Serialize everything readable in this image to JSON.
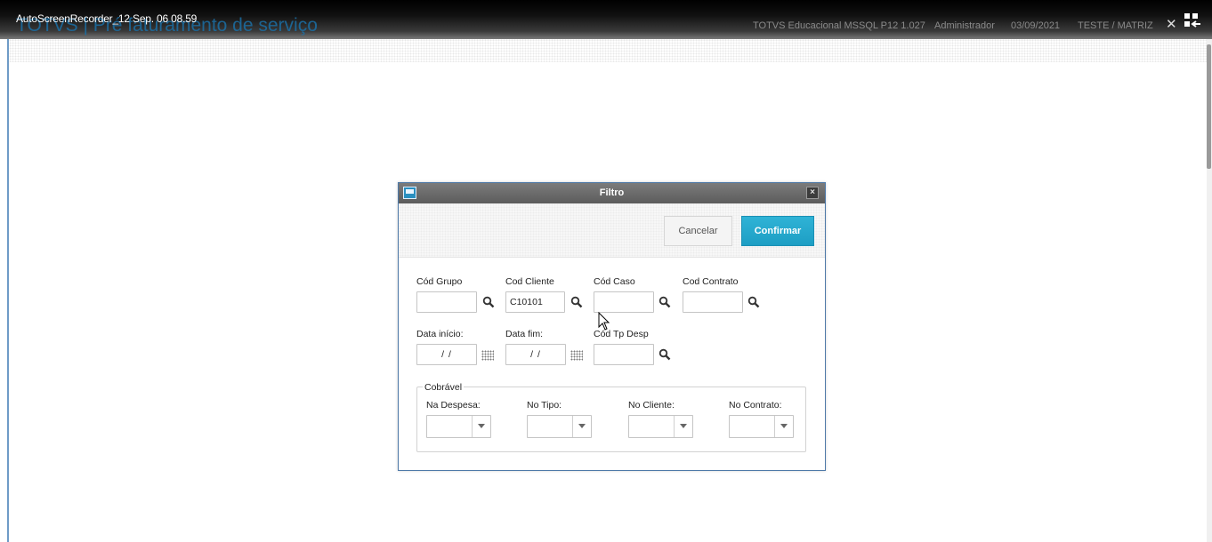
{
  "recorder": {
    "title": "AutoScreenRecorder_12 Sep. 06 08.59"
  },
  "app": {
    "title": "TOTVS | Pré faturamento de serviço",
    "environment": "TOTVS Educacional MSSQL P12 1.027",
    "user": "Administrador",
    "date": "03/09/2021",
    "company": "TESTE / MATRIZ"
  },
  "dialog": {
    "title": "Filtro",
    "cancel_label": "Cancelar",
    "confirm_label": "Confirmar",
    "fields": {
      "cod_grupo": {
        "label": "Cód Grupo",
        "value": ""
      },
      "cod_cliente": {
        "label": "Cod Cliente",
        "value": "C10101"
      },
      "cod_caso": {
        "label": "Cód Caso",
        "value": ""
      },
      "cod_contrato": {
        "label": "Cod Contrato",
        "value": ""
      },
      "data_inicio": {
        "label": "Data início:",
        "value": " / /"
      },
      "data_fim": {
        "label": "Data fim:",
        "value": " / /"
      },
      "cod_tp_desp": {
        "label": "Cód Tp Desp",
        "value": ""
      }
    },
    "cobravel": {
      "legend": "Cobrável",
      "na_despesa": {
        "label": "Na Despesa:",
        "value": ""
      },
      "no_tipo": {
        "label": "No Tipo:",
        "value": ""
      },
      "no_cliente": {
        "label": "No Cliente:",
        "value": ""
      },
      "no_contrato": {
        "label": "No Contrato:",
        "value": ""
      }
    }
  },
  "icons": {
    "search": "search-icon",
    "calendar": "calendar-icon",
    "close": "close-icon",
    "menu": "grid-menu-icon",
    "dropdown": "chevron-down-icon"
  },
  "colors": {
    "accent": "#1d9ec4",
    "app_title": "#1b6fa5",
    "dialog_header": "#6a6a6a"
  }
}
